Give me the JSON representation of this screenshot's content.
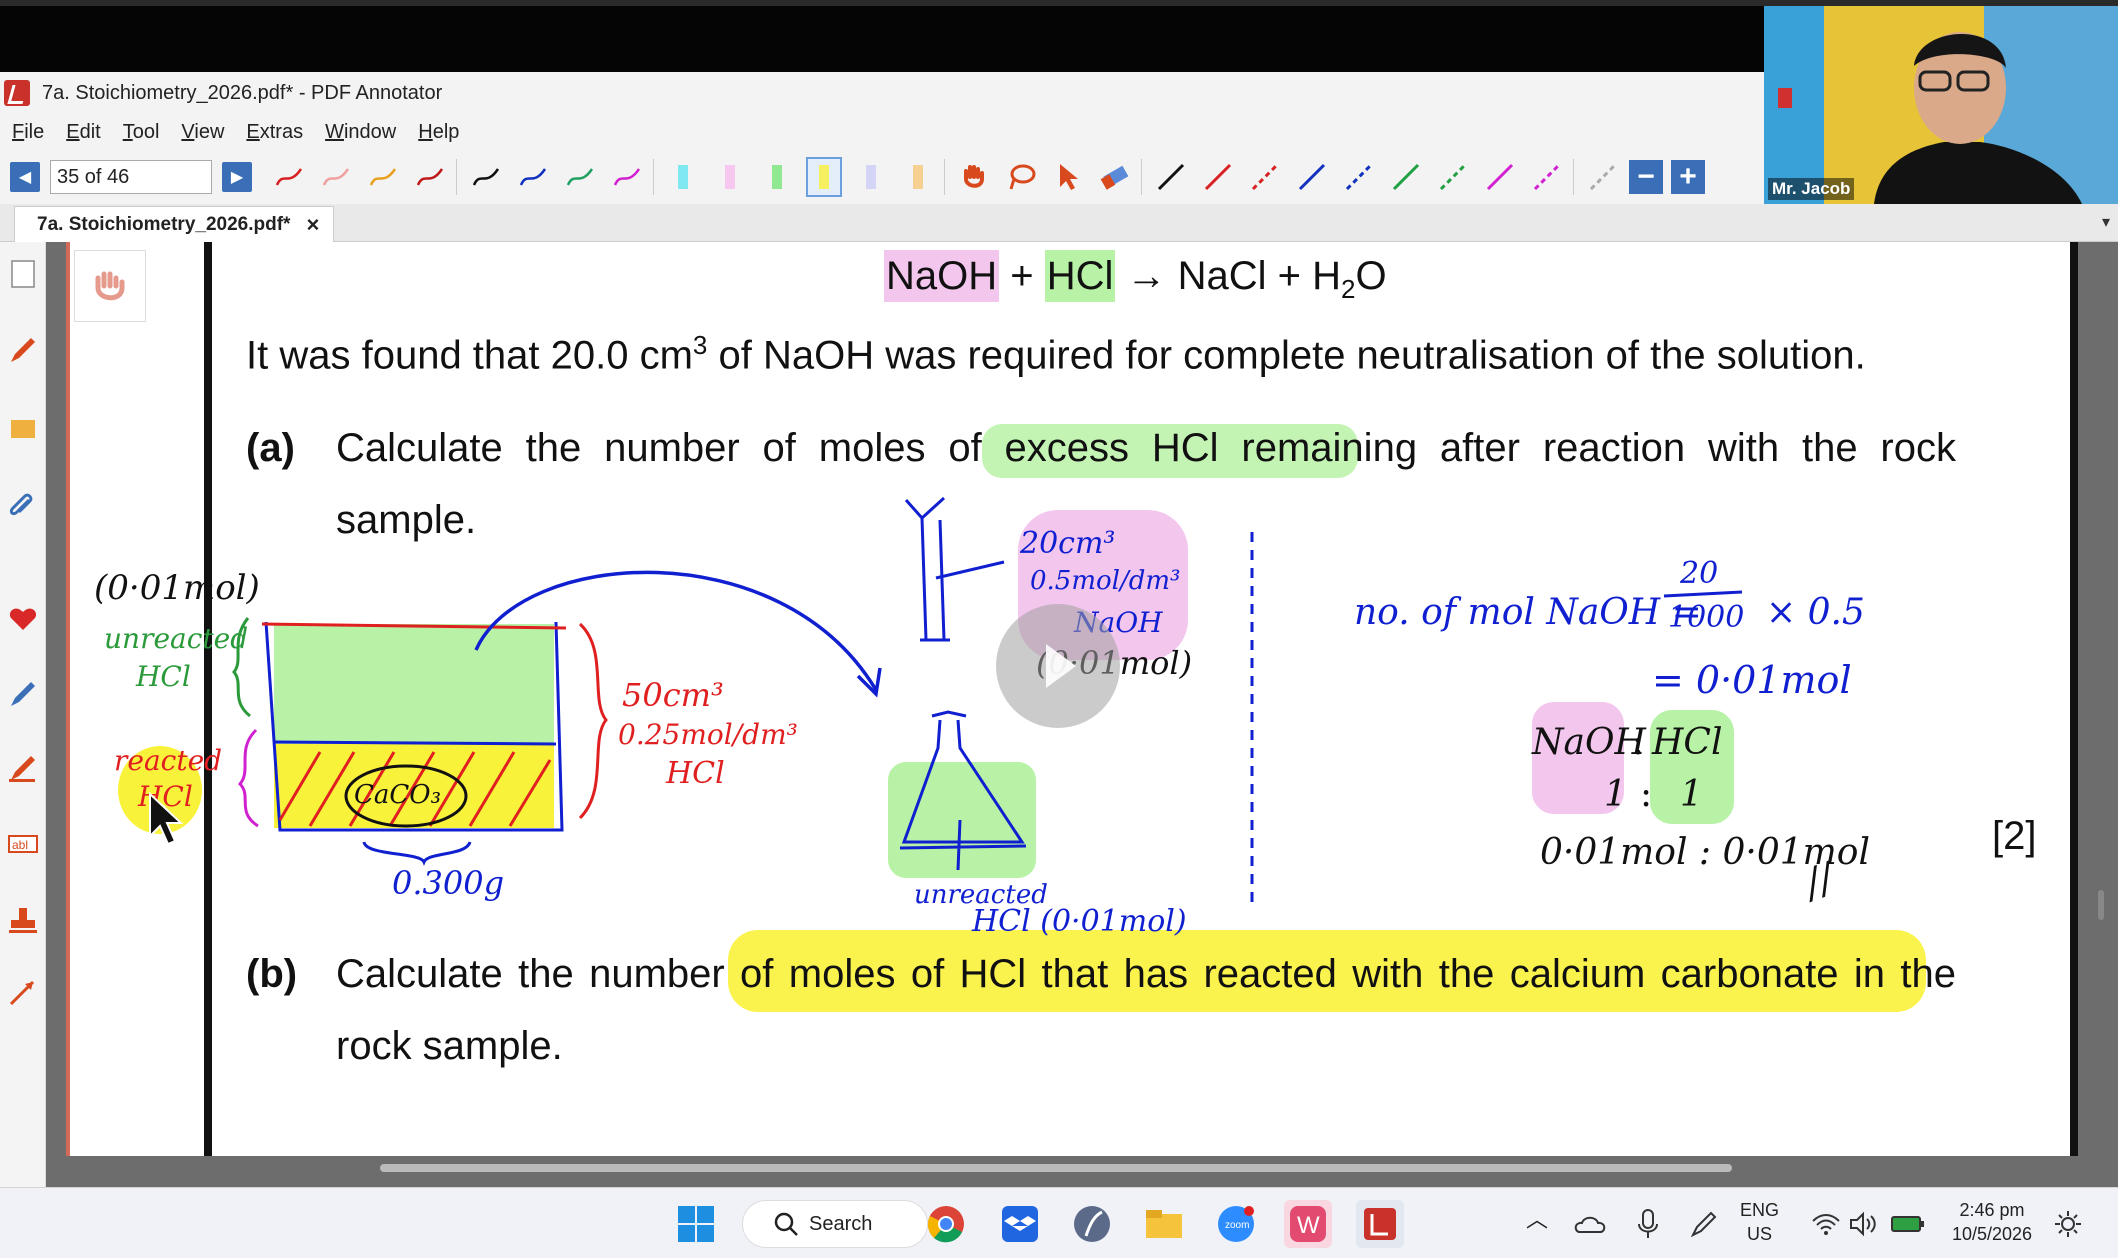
{
  "window": {
    "title": "7a. Stoichiometry_2026.pdf* - PDF Annotator"
  },
  "menu": [
    "File",
    "Edit",
    "Tool",
    "View",
    "Extras",
    "Window",
    "Help"
  ],
  "toolbar": {
    "page_indicator": "35 of 46"
  },
  "tab": {
    "label": "7a. Stoichiometry_2026.pdf*",
    "close": "×"
  },
  "webcam": {
    "name": "Mr. Jacob"
  },
  "document": {
    "equation": {
      "naoh": "NaOH",
      "plus1": "+",
      "hcl": "HCl",
      "rest": "→ NaCl + H",
      "sub2": "2",
      "o": "O"
    },
    "sentence1": "It was found that 20.0 cm",
    "sentence1_sup": "3",
    "sentence1_tail": " of NaOH was required for complete neutralisation of the solution.",
    "part_a_label": "(a)",
    "part_a_line1": "Calculate the number of moles of excess HCl remaining after reaction with the rock",
    "part_a_line2": "sample.",
    "marks_a": "[2]",
    "part_b_label": "(b)",
    "part_b_line1": "Calculate the number of moles of HCl that has reacted with the calcium carbonate in the",
    "part_b_line2": "rock sample."
  },
  "handwriting": {
    "left_mol": "(0·01mol)",
    "unreacted_hcl_1": "unreacted",
    "unreacted_hcl_2": "HCl",
    "reacted_1": "reacted",
    "reacted_2": "HCl",
    "beaker_vol": "50cm³",
    "beaker_conc": "0.25mol/dm³",
    "beaker_hcl": "HCl",
    "caco3": "CaCO₃",
    "mass": "0.300g",
    "burette_vol": "20cm³",
    "burette_conc": "0.5mol/dm³",
    "burette_naoh": "NaOH",
    "burette_mol": "(0·01mol)",
    "flask_label_1": "unreacted",
    "flask_label_2": "HCl (0·01mol)",
    "calc_lhs": "no. of mol NaOH =",
    "calc_num": "20",
    "calc_den": "1000",
    "calc_mult": "× 0.5",
    "calc_result": "= 0·01mol",
    "ratio_naoh": "NaOH",
    "ratio_colon": ":",
    "ratio_hcl": "HCl",
    "ratio_1a": "1",
    "ratio_colon2": ":",
    "ratio_1b": "1",
    "ratio_mol": "0·01mol : 0·01mol",
    "ratio_mark": "//"
  },
  "taskbar": {
    "search": "Search",
    "lang1": "ENG",
    "lang2": "US",
    "time": "2:46 pm",
    "date": "10/5/2026"
  },
  "colors": {
    "annotation_blue": "#1020d0",
    "annotation_red": "#e02020",
    "annotation_green": "#2a9a3a",
    "highlight_yellow": "#f9f23b",
    "highlight_green": "#b8f2a6",
    "highlight_pink": "#f3c6ee"
  }
}
